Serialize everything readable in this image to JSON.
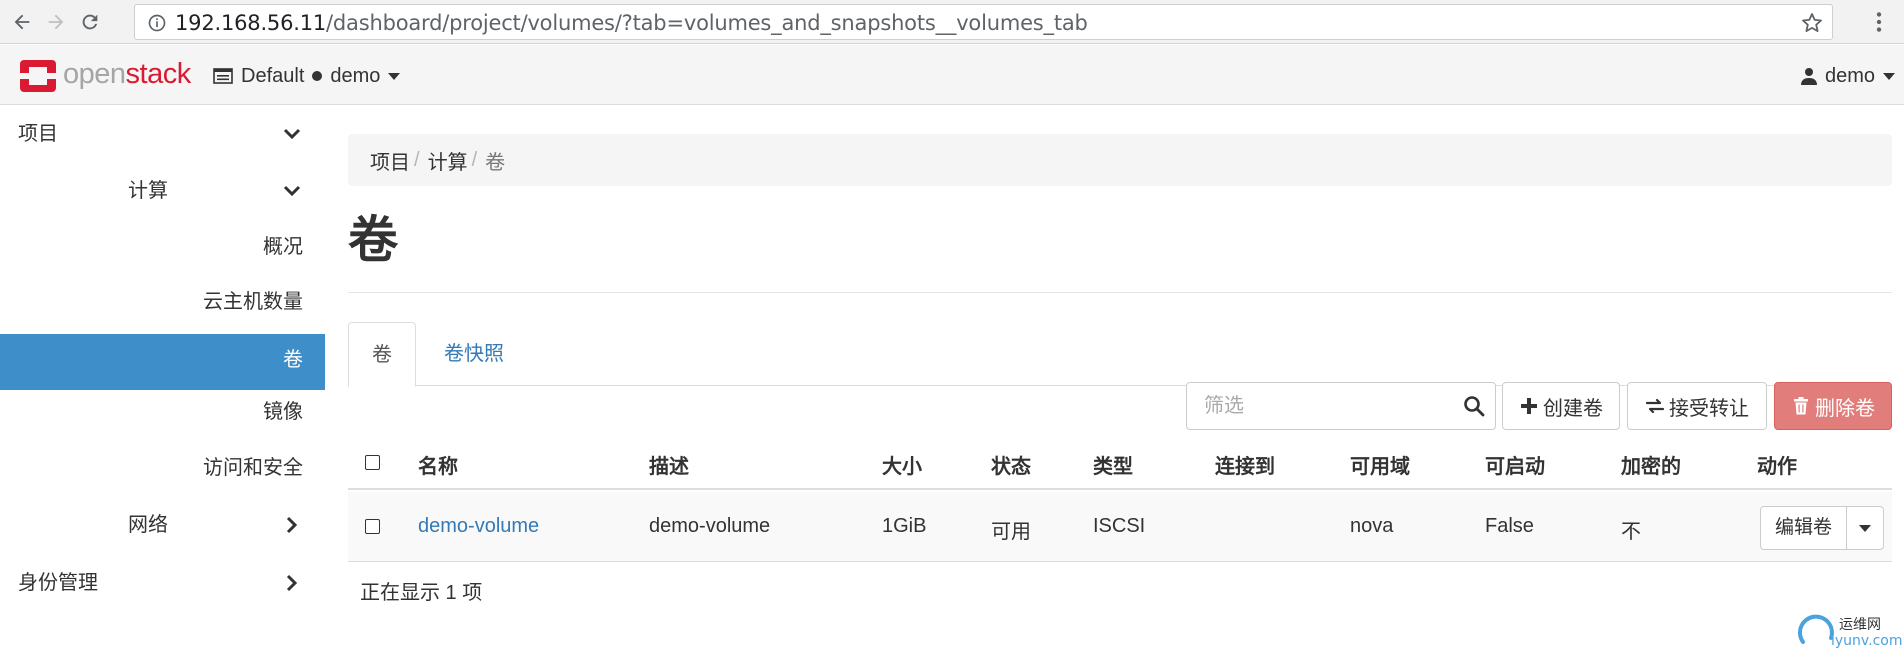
{
  "browser": {
    "url_host": "192.168.56.11",
    "url_path": "/dashboard/project/volumes/?tab=volumes_and_snapshots__volumes_tab"
  },
  "header": {
    "logo_open": "open",
    "logo_stack": "stack",
    "domain": "Default",
    "project": "demo",
    "user": "demo",
    "brand_color": "#da1a32"
  },
  "sidebar": {
    "items": [
      {
        "label": "项目",
        "level": 1,
        "icon": "chevron-down-icon"
      },
      {
        "label": "计算",
        "level": 2,
        "icon": "chevron-down-icon"
      },
      {
        "label": "概况",
        "level": 3
      },
      {
        "label": "云主机数量",
        "level": 3
      },
      {
        "label": "卷",
        "level": 3,
        "active": true
      },
      {
        "label": "镜像",
        "level": 3
      },
      {
        "label": "访问和安全",
        "level": 3
      },
      {
        "label": "网络",
        "level": 2,
        "icon": "chevron-right-icon"
      },
      {
        "label": "身份管理",
        "level": 1,
        "icon": "chevron-right-icon"
      }
    ],
    "active_color": "#3d8ec9"
  },
  "breadcrumb": [
    "项目",
    "计算",
    "卷"
  ],
  "page_title": "卷",
  "tabs": [
    {
      "label": "卷",
      "active": true
    },
    {
      "label": "卷快照",
      "active": false
    }
  ],
  "toolbar": {
    "filter_placeholder": "筛选",
    "create_label": "创建卷",
    "accept_label": "接受转让",
    "delete_label": "删除卷",
    "delete_color": "#e17d7b"
  },
  "table": {
    "columns": [
      "名称",
      "描述",
      "大小",
      "状态",
      "类型",
      "连接到",
      "可用域",
      "可启动",
      "加密的",
      "动作"
    ],
    "rows": [
      {
        "name": "demo-volume",
        "description": "demo-volume",
        "size": "1GiB",
        "status": "可用",
        "type": "ISCSI",
        "attached_to": "",
        "zone": "nova",
        "bootable": "False",
        "encrypted": "不",
        "action": "编辑卷"
      }
    ],
    "count_text": "正在显示 1 项"
  },
  "watermark": {
    "line1": "运维网",
    "line2": "iyunv.com"
  }
}
